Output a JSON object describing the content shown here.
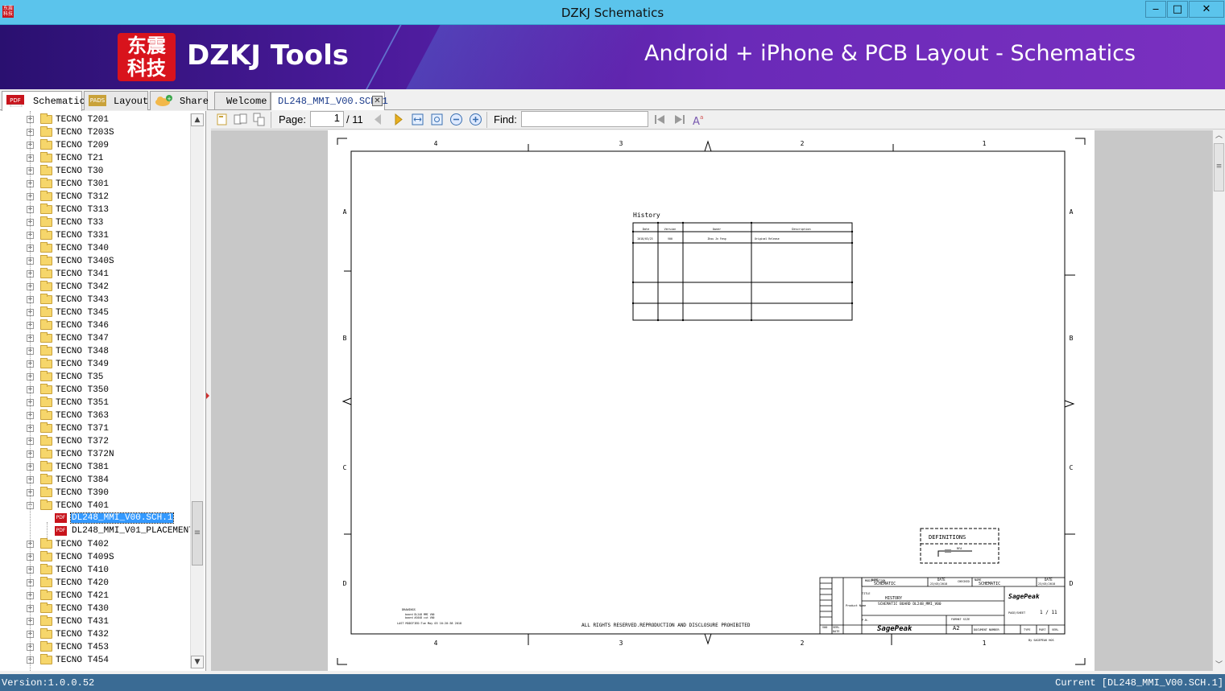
{
  "window": {
    "title": "DZKJ Schematics",
    "minimize": "‒",
    "maximize": "□",
    "close": "✕"
  },
  "banner": {
    "logo_line1": "东震",
    "logo_line2": "科技",
    "brand": "DZKJ Tools",
    "tagline": "Android + iPhone & PCB Layout - Schematics"
  },
  "left_tabs": [
    {
      "label": "Schematic",
      "icon": "PDF"
    },
    {
      "label": "Layout",
      "icon": "PADS"
    },
    {
      "label": "Share",
      "icon": "cloud"
    }
  ],
  "doc_tabs": [
    {
      "label": "Welcome"
    },
    {
      "label": "DL248_MMI_V00.SCH.1"
    }
  ],
  "tree": {
    "items": [
      "TECNO T201",
      "TECNO T203S",
      "TECNO T209",
      "TECNO T21",
      "TECNO T30",
      "TECNO T301",
      "TECNO T312",
      "TECNO T313",
      "TECNO T33",
      "TECNO T331",
      "TECNO T340",
      "TECNO T340S",
      "TECNO T341",
      "TECNO T342",
      "TECNO T343",
      "TECNO T345",
      "TECNO T346",
      "TECNO T347",
      "TECNO T348",
      "TECNO T349",
      "TECNO T35",
      "TECNO T350",
      "TECNO T351",
      "TECNO T363",
      "TECNO T371",
      "TECNO T372",
      "TECNO T372N",
      "TECNO T381",
      "TECNO T384",
      "TECNO T390"
    ],
    "expanded": "TECNO T401",
    "files": [
      "DL248_MMI_V00.SCH.1",
      "DL248_MMI_V01_PLACEMENT"
    ],
    "items_after": [
      "TECNO T402",
      "TECNO T409S",
      "TECNO T410",
      "TECNO T420",
      "TECNO T421",
      "TECNO T430",
      "TECNO T431",
      "TECNO T432",
      "TECNO T453",
      "TECNO T454"
    ]
  },
  "toolbar": {
    "page_label": "Page:",
    "page_value": "1",
    "page_total": "/ 11",
    "find_label": "Find:",
    "find_value": ""
  },
  "schematic": {
    "col_labels": [
      "4",
      "3",
      "2",
      "1"
    ],
    "row_labels": [
      "A",
      "B",
      "C",
      "D"
    ],
    "history_title": "History",
    "history_headers": [
      "Date",
      "Version",
      "Owner",
      "Description"
    ],
    "history_row": [
      "2018/03/23",
      "V00",
      "Zhou Jn Feng",
      "Original Release"
    ],
    "definitions": "DEFINITIONS",
    "definitions_sub": "RFA",
    "rights": "ALL RIGHTS RESERVED.REPRODUCTION AND DISCLOSURE PROHIBITED",
    "drawing_note": [
      "DRAWINGS",
      "board DL248 MMI V00",
      "board #1048 cut V00",
      "LAST MODIFIED:Tue May 03 10:20:38 2018"
    ],
    "tb_name_label": "NAME",
    "tb_name_left": "SCHEMATIC",
    "tb_date_label": "DATE",
    "tb_date_left": "23/03/2018",
    "tb_checked": "CHECKED",
    "tb_name_right": "SCHEMATIC",
    "tb_date_right": "23/03/2018",
    "tb_modification": "MODIFICATION",
    "tb_title_label": "TITLE",
    "tb_title": "HISTORY",
    "tb_product_label": "Product Name",
    "tb_product": "SCHEMATIC BOARD DL248_MMI_V00",
    "tb_pn": "P.N.",
    "tb_format_label": "FORMAT SIZE",
    "tb_format": "A2",
    "tb_docnum": "DOCUMENT NUMBER",
    "tb_type": "TYPE",
    "tb_part": "PART",
    "tb_verl": "VERL",
    "tb_pagesheet": "PAGE/SHEET",
    "tb_pages": "1 / 11",
    "tb_logo": "SagePeak",
    "tb_ver_label": "V00",
    "tb_verl_label": "VERL",
    "tb_date_small": "DATE",
    "tb_by": "By SAGEPEAK HOS"
  },
  "status": {
    "version": "Version:1.0.0.52",
    "current": "Current [DL248_MMI_V00.SCH.1]"
  }
}
